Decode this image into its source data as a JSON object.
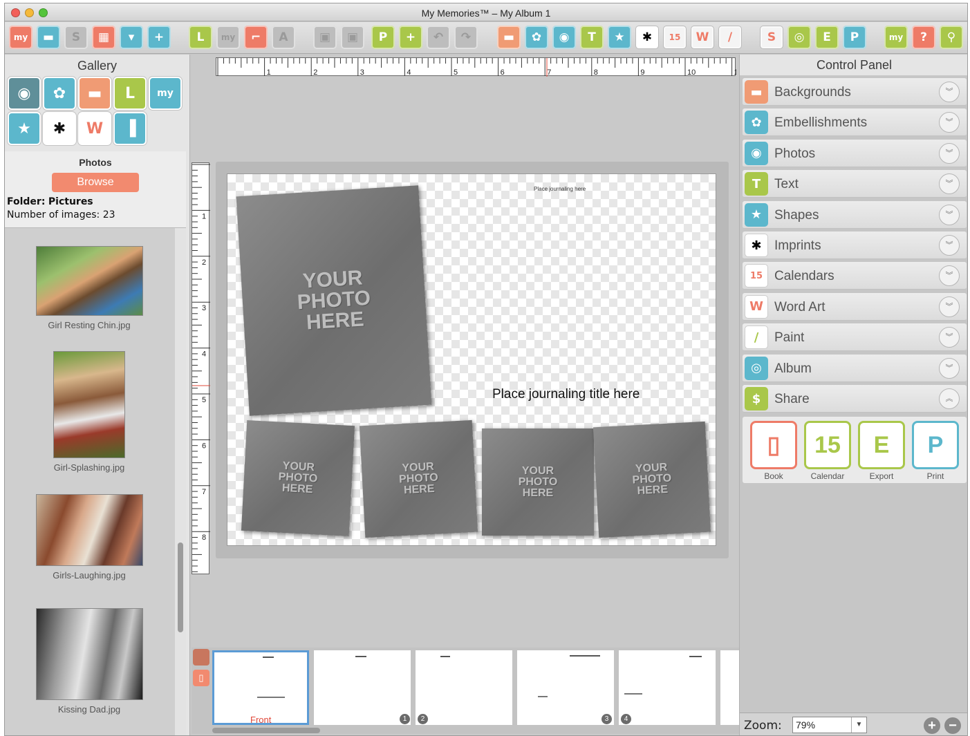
{
  "window": {
    "title": "My Memories™ – My Album 1"
  },
  "toolbar": {
    "icons": [
      {
        "name": "mycom-logo-icon",
        "glyph": "my",
        "bg": "#ee7b67"
      },
      {
        "name": "folder-icon",
        "glyph": "▬",
        "bg": "#5cb7cc"
      },
      {
        "name": "save-disabled-icon",
        "glyph": "S",
        "bg": "#bdbdbd"
      },
      {
        "name": "layout-icon",
        "glyph": "▦",
        "bg": "#ee7b67"
      },
      {
        "name": "download-icon",
        "glyph": "▾",
        "bg": "#5cb7cc"
      },
      {
        "name": "add-page-icon",
        "glyph": "+",
        "bg": "#5cb7cc"
      },
      {
        "name": "layout-l-icon",
        "glyph": "L",
        "bg": "#a9c74a"
      },
      {
        "name": "mycom-dim-icon",
        "glyph": "my",
        "bg": "#bdbdbd"
      },
      {
        "name": "crop-icon",
        "glyph": "⌐",
        "bg": "#ee7b67"
      },
      {
        "name": "text-dim-icon",
        "glyph": "A",
        "bg": "#bdbdbd"
      },
      {
        "name": "copy-dim-icon",
        "glyph": "▣",
        "bg": "#bdbdbd"
      },
      {
        "name": "paste-dim-icon",
        "glyph": "▣",
        "bg": "#bdbdbd"
      },
      {
        "name": "page-p-icon",
        "glyph": "P",
        "bg": "#a9c74a"
      },
      {
        "name": "page-plus-icon",
        "glyph": "+",
        "bg": "#a9c74a"
      },
      {
        "name": "undo-dim-icon",
        "glyph": "↶",
        "bg": "#bdbdbd"
      },
      {
        "name": "redo-dim-icon",
        "glyph": "↷",
        "bg": "#bdbdbd"
      },
      {
        "name": "backgrounds-icon",
        "glyph": "▬",
        "bg": "#f09b74"
      },
      {
        "name": "embellishments-icon",
        "glyph": "✿",
        "bg": "#5cb7cc"
      },
      {
        "name": "camera-icon",
        "glyph": "◉",
        "bg": "#5cb7cc"
      },
      {
        "name": "text-t-icon",
        "glyph": "T",
        "bg": "#a9c74a"
      },
      {
        "name": "shapes-star-icon",
        "glyph": "★",
        "bg": "#5cb7cc"
      },
      {
        "name": "butterfly-icon",
        "glyph": "✱",
        "bg": "#ffffff"
      },
      {
        "name": "calendar-icon",
        "glyph": "15",
        "bg": "#f4f4f4"
      },
      {
        "name": "wordart-icon",
        "glyph": "W",
        "bg": "#f4f4f4"
      },
      {
        "name": "paint-brush-icon",
        "glyph": "/",
        "bg": "#f4f4f4"
      },
      {
        "name": "share-s-icon",
        "glyph": "S",
        "bg": "#f4f4f4"
      },
      {
        "name": "book-icon",
        "glyph": "◎",
        "bg": "#a9c74a"
      },
      {
        "name": "export-icon",
        "glyph": "E",
        "bg": "#a9c74a"
      },
      {
        "name": "print-icon",
        "glyph": "P",
        "bg": "#5cb7cc"
      },
      {
        "name": "mycom-cloud-icon",
        "glyph": "my",
        "bg": "#a9c74a"
      },
      {
        "name": "help-icon",
        "glyph": "?",
        "bg": "#ee7b67"
      },
      {
        "name": "search-icon",
        "glyph": "⚲",
        "bg": "#a9c74a"
      }
    ]
  },
  "gallery": {
    "title": "Gallery",
    "tools": [
      {
        "name": "gallery-photos-icon",
        "glyph": "◉",
        "bg": "#5f8f99"
      },
      {
        "name": "gallery-embellishments-icon",
        "glyph": "✿",
        "bg": "#5cb7cc"
      },
      {
        "name": "gallery-backgrounds-icon",
        "glyph": "▬",
        "bg": "#f09b74"
      },
      {
        "name": "gallery-layouts-icon",
        "glyph": "L",
        "bg": "#a9c74a"
      },
      {
        "name": "gallery-mycom-icon",
        "glyph": "my",
        "bg": "#5cb7cc"
      },
      {
        "name": "gallery-shapes-icon",
        "glyph": "★",
        "bg": "#5cb7cc"
      },
      {
        "name": "gallery-imprints-icon",
        "glyph": "✱",
        "bg": "#ffffff"
      },
      {
        "name": "gallery-wordart-icon",
        "glyph": "W",
        "bg": "#ffffff"
      },
      {
        "name": "gallery-templates-icon",
        "glyph": "▐",
        "bg": "#5cb7cc"
      }
    ],
    "photos_label": "Photos",
    "browse_label": "Browse",
    "folder_label": "Folder:",
    "folder_value": "Pictures",
    "count_label": "Number of images:",
    "count_value": "23",
    "images": [
      {
        "caption": "Girl Resting Chin.jpg"
      },
      {
        "caption": "Girl-Splashing.jpg"
      },
      {
        "caption": "Girls-Laughing.jpg"
      },
      {
        "caption": "Kissing Dad.jpg"
      }
    ]
  },
  "ruler": {
    "top": [
      "1",
      "2",
      "3",
      "4",
      "5",
      "6",
      "7",
      "8",
      "9",
      "10",
      "1"
    ],
    "left": [
      "1",
      "2",
      "3",
      "4",
      "5",
      "6",
      "7",
      "8"
    ]
  },
  "canvas": {
    "placeholder": {
      "line1": "YOUR",
      "line2": "PHOTO",
      "line3": "HERE"
    },
    "journaling_small": "Place journaling here",
    "journaling_title": "Place journaling title here"
  },
  "pages": {
    "front_label": "Front",
    "numbers": [
      "1",
      "2",
      "3",
      "4"
    ]
  },
  "control_panel": {
    "title": "Control Panel",
    "items": [
      {
        "label": "Backgrounds",
        "icon": "backgrounds-icon",
        "glyph": "▬",
        "bg": "#f09b74",
        "state": "collapsed"
      },
      {
        "label": "Embellishments",
        "icon": "embellishments-icon",
        "glyph": "✿",
        "bg": "#5cb7cc",
        "state": "collapsed"
      },
      {
        "label": "Photos",
        "icon": "camera-icon",
        "glyph": "◉",
        "bg": "#5cb7cc",
        "state": "collapsed"
      },
      {
        "label": "Text",
        "icon": "text-icon",
        "glyph": "T",
        "bg": "#a9c74a",
        "state": "collapsed"
      },
      {
        "label": "Shapes",
        "icon": "star-icon",
        "glyph": "★",
        "bg": "#5cb7cc",
        "state": "collapsed"
      },
      {
        "label": "Imprints",
        "icon": "butterfly-icon",
        "glyph": "✱",
        "bg": "#ffffff",
        "state": "collapsed"
      },
      {
        "label": "Calendars",
        "icon": "calendar-icon",
        "glyph": "15",
        "bg": "#ffffff",
        "state": "collapsed"
      },
      {
        "label": "Word Art",
        "icon": "wordart-icon",
        "glyph": "W",
        "bg": "#ffffff",
        "state": "collapsed"
      },
      {
        "label": "Paint",
        "icon": "paint-brush-icon",
        "glyph": "/",
        "bg": "#ffffff",
        "state": "collapsed"
      },
      {
        "label": "Album",
        "icon": "album-icon",
        "glyph": "◎",
        "bg": "#5cb7cc",
        "state": "collapsed"
      },
      {
        "label": "Share",
        "icon": "share-icon",
        "glyph": "$",
        "bg": "#a9c74a",
        "state": "expanded"
      }
    ],
    "share_buttons": [
      {
        "label": "Book",
        "icon": "book-icon",
        "glyph": "▯",
        "color": "#ee7b67"
      },
      {
        "label": "Calendar",
        "icon": "calendar-icon",
        "glyph": "15",
        "color": "#a9c74a"
      },
      {
        "label": "Export",
        "icon": "export-icon",
        "glyph": "E",
        "color": "#a9c74a"
      },
      {
        "label": "Print",
        "icon": "print-icon",
        "glyph": "P",
        "color": "#5cb7cc"
      }
    ],
    "zoom_label": "Zoom:",
    "zoom_value": "79%"
  },
  "colors": {
    "coral": "#ee7b67",
    "teal": "#5cb7cc",
    "green": "#a9c74a",
    "orange": "#f09b74"
  }
}
